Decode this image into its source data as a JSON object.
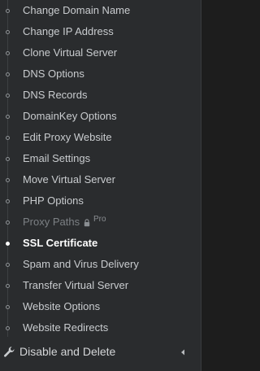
{
  "submenu": {
    "items": [
      {
        "label": "Change Domain Name"
      },
      {
        "label": "Change IP Address"
      },
      {
        "label": "Clone Virtual Server"
      },
      {
        "label": "DNS Options"
      },
      {
        "label": "DNS Records"
      },
      {
        "label": "DomainKey Options"
      },
      {
        "label": "Edit Proxy Website"
      },
      {
        "label": "Email Settings"
      },
      {
        "label": "Move Virtual Server"
      },
      {
        "label": "PHP Options"
      },
      {
        "label": "Proxy Paths",
        "badge": "Pro"
      },
      {
        "label": "SSL Certificate"
      },
      {
        "label": "Spam and Virus Delivery"
      },
      {
        "label": "Transfer Virtual Server"
      },
      {
        "label": "Website Options"
      },
      {
        "label": "Website Redirects"
      }
    ]
  },
  "section": {
    "label": "Disable and Delete",
    "icon": "wrench-icon",
    "caret_icon": "caret-left-icon"
  },
  "colors": {
    "sidebar_bg": "#2a2c2e",
    "text": "#c9cccf",
    "active_text": "#ffffff",
    "disabled_text": "#7c8084"
  }
}
